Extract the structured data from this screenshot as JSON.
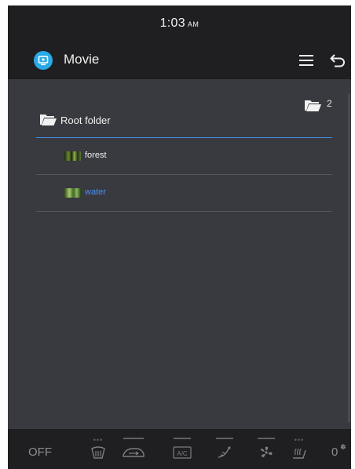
{
  "status_bar": {
    "time": "1:03",
    "ampm": "AM"
  },
  "app_bar": {
    "title": "Movie",
    "app_icon": "movie-app-icon",
    "menu_icon": "hamburger-menu-icon",
    "back_icon": "back-arrow-icon"
  },
  "content": {
    "folder_count": "2",
    "root_folder": {
      "label": "Root folder",
      "icon": "folder-open-icon"
    },
    "files": [
      {
        "name": "forest",
        "selected": false,
        "thumbnail": "forest-thumbnail"
      },
      {
        "name": "water",
        "selected": true,
        "thumbnail": "water-thumbnail"
      }
    ]
  },
  "climate_bar": {
    "off_label": "OFF",
    "fan_level": "0",
    "controls": [
      {
        "icon": "rear-window-defrost-icon"
      },
      {
        "icon": "recirculation-icon"
      },
      {
        "icon": "ac-icon",
        "label": "A/C"
      },
      {
        "icon": "airflow-mode-icon"
      },
      {
        "icon": "fan-icon"
      },
      {
        "icon": "seat-heat-icon"
      }
    ]
  },
  "colors": {
    "background": "#393a3f",
    "bar_background": "#1f1f21",
    "accent": "#3f8ee8",
    "selected_text": "#4a90f0",
    "app_icon": "#29a9e6"
  }
}
